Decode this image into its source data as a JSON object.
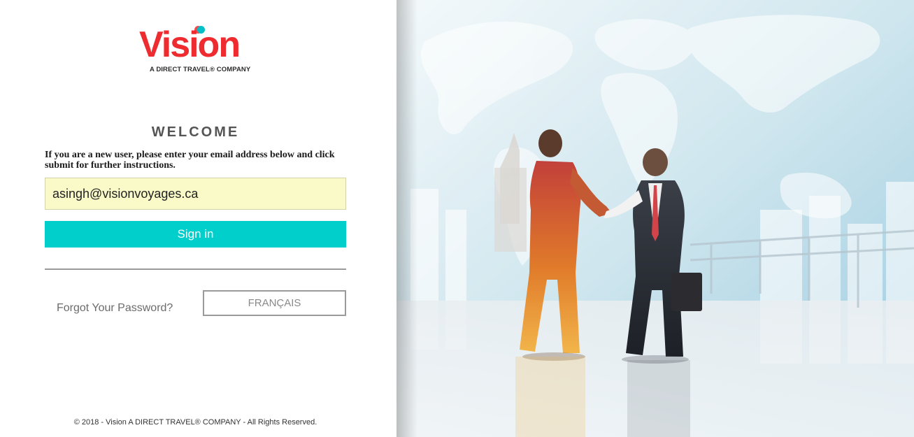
{
  "logo": {
    "wordmark": "Vision",
    "tagline": "A DIRECT TRAVEL® COMPANY"
  },
  "welcome": {
    "heading": "WELCOME",
    "instructions": "If you are a new user, please enter your email address below and click submit for further instructions."
  },
  "form": {
    "email_value": "asingh@visionvoyages.ca",
    "signin_label": "Sign in"
  },
  "links": {
    "forgot_password": "Forgot Your Password?",
    "language": "FRANÇAIS"
  },
  "footer": {
    "copyright": "© 2018 - Vision A DIRECT TRAVEL® COMPANY - All Rights Reserved."
  },
  "colors": {
    "brand_red": "#ee2b2f",
    "brand_teal": "#00cfcb",
    "field_bg": "#fafac8"
  },
  "hero": {
    "image": "business-handshake-world-map-icon"
  }
}
